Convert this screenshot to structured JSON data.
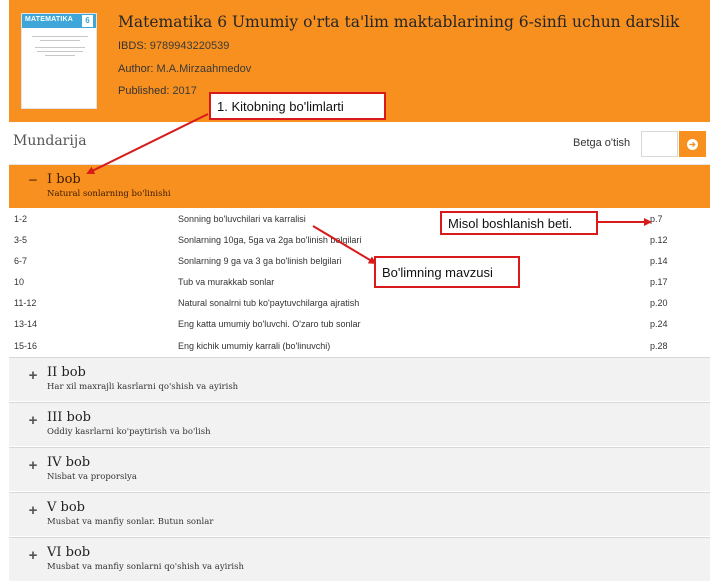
{
  "book": {
    "cover_title": "MATEMATIKA",
    "cover_number": "6",
    "title": "Matematika 6 Umumiy o'rta ta'lim maktablarining 6-sinfi uchun darslik",
    "isbn_label": "IBDS:",
    "isbn_value": "9789943220539",
    "author_label": "Author:",
    "author_value": "M.A.Mirzaahmedov",
    "published_label": "Published:",
    "published_value": "2017"
  },
  "toc": {
    "title": "Mundarija",
    "goto_label": "Betga o'tish",
    "goto_value": "",
    "goto_icon": "arrow-right-circle-icon"
  },
  "chapters": [
    {
      "name": "I bob",
      "subtitle": "Natural sonlarning bo'linishi",
      "toggle": "−",
      "expanded": true,
      "lessons": [
        {
          "pages": "1-2",
          "topic": "Sonning bo'luvchilari va karralisi",
          "start": "p.7"
        },
        {
          "pages": "3-5",
          "topic": "Sonlarning 10ga, 5ga va 2ga bo'linish belgilari",
          "start": "p.12"
        },
        {
          "pages": "6-7",
          "topic": "Sonlarning 9 ga va 3 ga bo'linish belgilari",
          "start": "p.14"
        },
        {
          "pages": "10",
          "topic": "Tub va murakkab sonlar",
          "start": "p.17"
        },
        {
          "pages": "11-12",
          "topic": "Natural sonalrni tub ko'paytuvchilarga ajratish",
          "start": "p.20"
        },
        {
          "pages": "13-14",
          "topic": "Eng katta umumiy bo'luvchi. O'zaro tub sonlar",
          "start": "p.24"
        },
        {
          "pages": "15-16",
          "topic": "Eng kichik umumiy karrali (bo'linuvchi)",
          "start": "p.28"
        }
      ]
    },
    {
      "name": "II bob",
      "subtitle": "Har xil maxrajli kasrlarni qo'shish va ayirish",
      "toggle": "+",
      "expanded": false
    },
    {
      "name": "III bob",
      "subtitle": "Oddiy kasrlarni ko'paytirish va bo'lish",
      "toggle": "+",
      "expanded": false
    },
    {
      "name": "IV bob",
      "subtitle": "Nisbat va proporsiya",
      "toggle": "+",
      "expanded": false
    },
    {
      "name": "V bob",
      "subtitle": "Musbat va manfiy sonlar. Butun sonlar",
      "toggle": "+",
      "expanded": false
    },
    {
      "name": "VI bob",
      "subtitle": "Musbat va manfiy sonlarni qo'shish va ayirish",
      "toggle": "+",
      "expanded": false
    }
  ],
  "annotations": {
    "chapters_note": "1. Kitobning bo'limlarti",
    "start_page_note": "Misol boshlanish beti.",
    "topic_note": "Bo'limning mavzusi",
    "color": "#d81a1a"
  },
  "colors": {
    "accent": "#f7901e",
    "cover_band": "#3ea6d8"
  }
}
